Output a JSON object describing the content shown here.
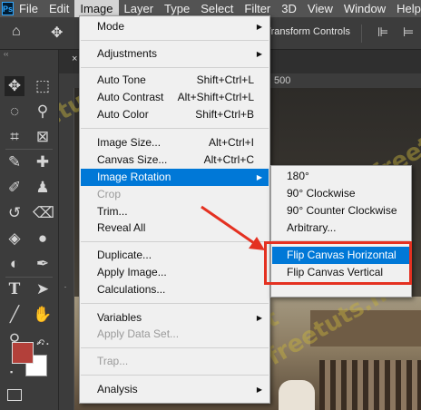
{
  "app": {
    "logo_text": "Ps"
  },
  "menubar": {
    "items": [
      "File",
      "Edit",
      "Image",
      "Layer",
      "Type",
      "Select",
      "Filter",
      "3D",
      "View",
      "Window",
      "Help"
    ],
    "active": "Image"
  },
  "options_bar": {
    "transform_controls_label": "Transform Controls"
  },
  "ruler": {
    "visible_number": "500"
  },
  "image_menu": {
    "items": [
      {
        "label": "Mode",
        "shortcut": "",
        "submenu": true
      },
      {
        "label": "Adjustments",
        "shortcut": "",
        "submenu": true
      },
      {
        "label": "Auto Tone",
        "shortcut": "Shift+Ctrl+L"
      },
      {
        "label": "Auto Contrast",
        "shortcut": "Alt+Shift+Ctrl+L"
      },
      {
        "label": "Auto Color",
        "shortcut": "Shift+Ctrl+B"
      },
      {
        "label": "Image Size...",
        "shortcut": "Alt+Ctrl+I"
      },
      {
        "label": "Canvas Size...",
        "shortcut": "Alt+Ctrl+C"
      },
      {
        "label": "Image Rotation",
        "shortcut": "",
        "submenu": true,
        "highlighted": true
      },
      {
        "label": "Crop",
        "shortcut": "",
        "disabled": true
      },
      {
        "label": "Trim...",
        "shortcut": ""
      },
      {
        "label": "Reveal All",
        "shortcut": ""
      },
      {
        "label": "Duplicate...",
        "shortcut": ""
      },
      {
        "label": "Apply Image...",
        "shortcut": ""
      },
      {
        "label": "Calculations...",
        "shortcut": ""
      },
      {
        "label": "Variables",
        "shortcut": "",
        "submenu": true
      },
      {
        "label": "Apply Data Set...",
        "shortcut": "",
        "disabled": true
      },
      {
        "label": "Trap...",
        "shortcut": "",
        "disabled": true
      },
      {
        "label": "Analysis",
        "shortcut": "",
        "submenu": true
      }
    ]
  },
  "rotation_submenu": {
    "items": [
      {
        "label": "180°"
      },
      {
        "label": "90° Clockwise"
      },
      {
        "label": "90° Counter Clockwise"
      },
      {
        "label": "Arbitrary..."
      },
      {
        "label": "Flip Canvas Horizontal",
        "highlighted": true
      },
      {
        "label": "Flip Canvas Vertical"
      }
    ]
  },
  "watermark": {
    "text": "freetuts.net"
  },
  "colors": {
    "menu_highlight": "#0078d7",
    "annotation_red": "#e43121",
    "foreground_swatch": "#b3403a",
    "background_swatch": "#ffffff"
  }
}
